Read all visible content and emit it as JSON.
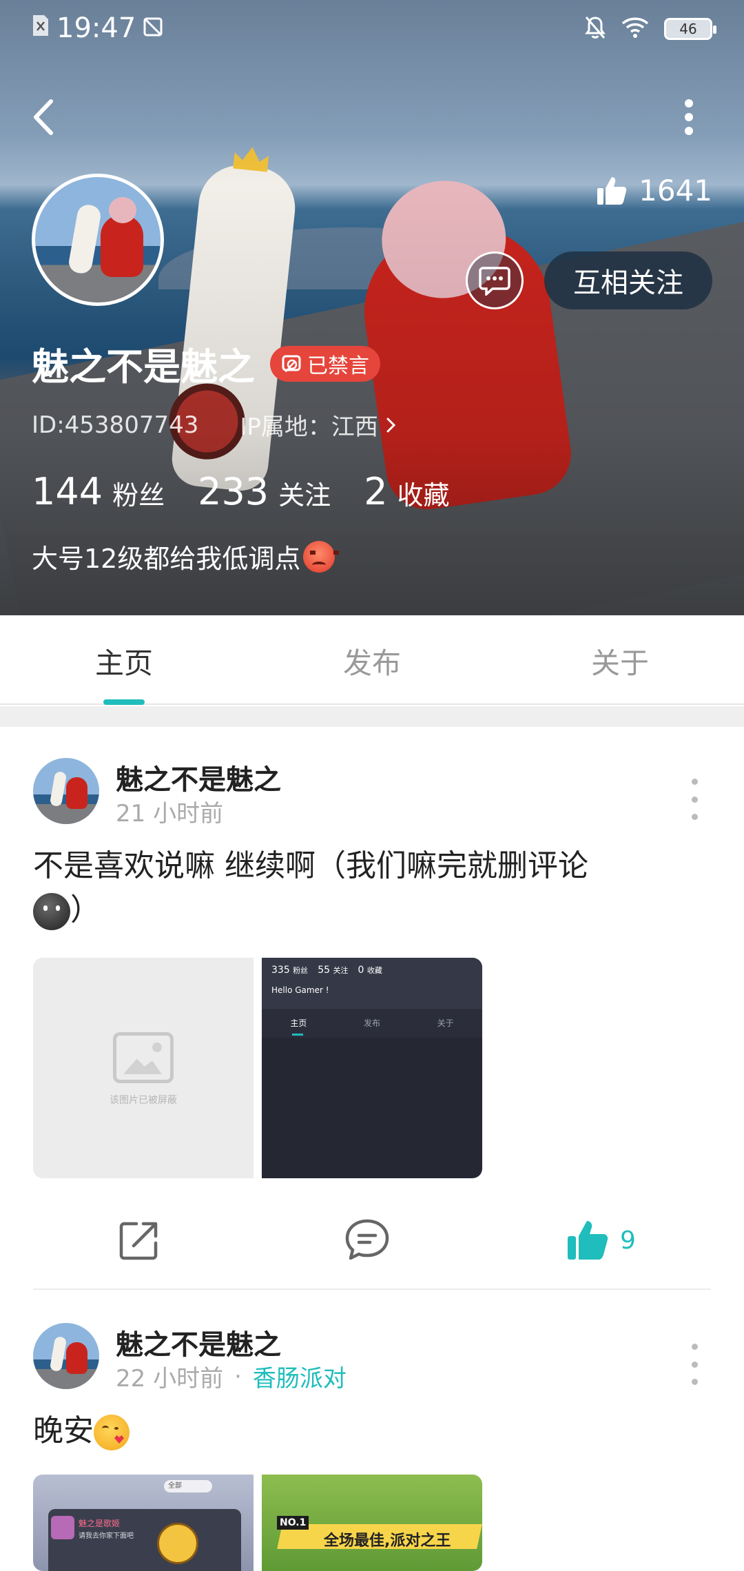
{
  "status_bar": {
    "time": "19:47",
    "battery": "46"
  },
  "profile": {
    "likes": "1641",
    "name": "魅之不是魅之",
    "banned_badge": "已禁言",
    "id_text": "ID:453807743",
    "ip_text": "IP属地：江西",
    "follow_button": "互相关注",
    "stats": [
      {
        "num": "144",
        "label": "粉丝"
      },
      {
        "num": "233",
        "label": "关注"
      },
      {
        "num": "2",
        "label": "收藏"
      }
    ],
    "bio": "大号12级都给我低调点"
  },
  "tabs": [
    {
      "label": "主页",
      "active": true
    },
    {
      "label": "发布",
      "active": false
    },
    {
      "label": "关于",
      "active": false
    }
  ],
  "posts": [
    {
      "author": "魅之不是魅之",
      "time": "21 小时前",
      "text": "不是喜欢说嘛 继续啊（我们嘛完就删评论",
      "text_end": "）",
      "blocked_image_text": "该图片已被屏蔽",
      "screenshot": {
        "fans": "335",
        "fans_label": "粉丝",
        "follow": "55",
        "follow_label": "关注",
        "fav": "0",
        "fav_label": "收藏",
        "hello": "Hello Gamer !",
        "tabs": [
          "主页",
          "发布",
          "关于"
        ]
      },
      "like_count": "9"
    },
    {
      "author": "魅之不是魅之",
      "time": "22 小时前",
      "separator": "·",
      "game": "香肠派对",
      "text": "晚安",
      "image1": {
        "select": "全部",
        "name": "魅之是歌姬",
        "sub": "请我去你家下面吧"
      },
      "image2": {
        "rank": "NO.1",
        "banner": "全场最佳,派对之王"
      }
    }
  ]
}
